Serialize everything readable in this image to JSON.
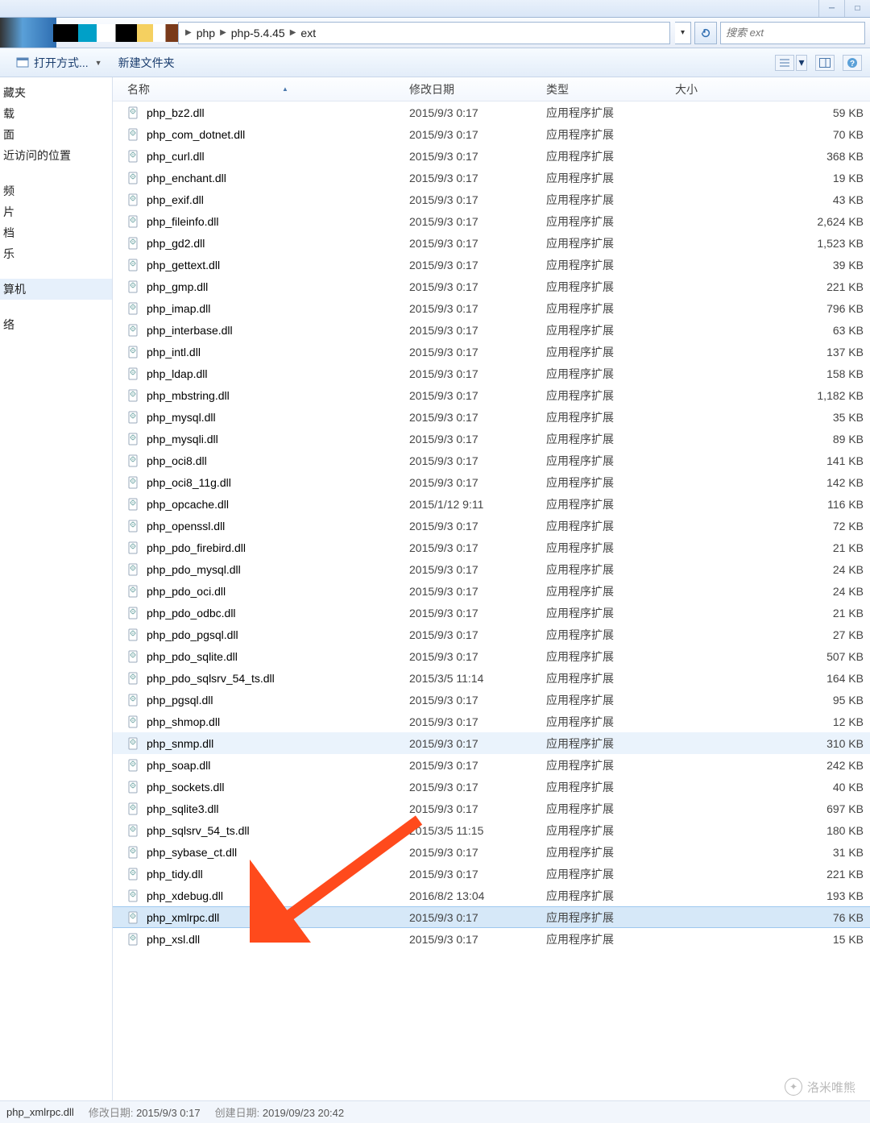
{
  "breadcrumb": {
    "seg1": "php",
    "seg2": "php-5.4.45",
    "seg3": "ext"
  },
  "search": {
    "placeholder": "搜索 ext"
  },
  "toolbar": {
    "open_with": "打开方式...",
    "new_folder": "新建文件夹"
  },
  "sidebar": {
    "items": [
      "藏夹",
      "载",
      "面",
      "近访问的位置",
      "",
      "频",
      "片",
      "档",
      "乐",
      "",
      "算机",
      "",
      "络"
    ],
    "selected_index": 10
  },
  "columns": {
    "name": "名称",
    "date": "修改日期",
    "type": "类型",
    "size": "大小"
  },
  "type_label": "应用程序扩展",
  "files": [
    {
      "n": "php_bz2.dll",
      "d": "2015/9/3 0:17",
      "s": "59 KB"
    },
    {
      "n": "php_com_dotnet.dll",
      "d": "2015/9/3 0:17",
      "s": "70 KB"
    },
    {
      "n": "php_curl.dll",
      "d": "2015/9/3 0:17",
      "s": "368 KB"
    },
    {
      "n": "php_enchant.dll",
      "d": "2015/9/3 0:17",
      "s": "19 KB"
    },
    {
      "n": "php_exif.dll",
      "d": "2015/9/3 0:17",
      "s": "43 KB"
    },
    {
      "n": "php_fileinfo.dll",
      "d": "2015/9/3 0:17",
      "s": "2,624 KB"
    },
    {
      "n": "php_gd2.dll",
      "d": "2015/9/3 0:17",
      "s": "1,523 KB"
    },
    {
      "n": "php_gettext.dll",
      "d": "2015/9/3 0:17",
      "s": "39 KB"
    },
    {
      "n": "php_gmp.dll",
      "d": "2015/9/3 0:17",
      "s": "221 KB"
    },
    {
      "n": "php_imap.dll",
      "d": "2015/9/3 0:17",
      "s": "796 KB"
    },
    {
      "n": "php_interbase.dll",
      "d": "2015/9/3 0:17",
      "s": "63 KB"
    },
    {
      "n": "php_intl.dll",
      "d": "2015/9/3 0:17",
      "s": "137 KB"
    },
    {
      "n": "php_ldap.dll",
      "d": "2015/9/3 0:17",
      "s": "158 KB"
    },
    {
      "n": "php_mbstring.dll",
      "d": "2015/9/3 0:17",
      "s": "1,182 KB"
    },
    {
      "n": "php_mysql.dll",
      "d": "2015/9/3 0:17",
      "s": "35 KB"
    },
    {
      "n": "php_mysqli.dll",
      "d": "2015/9/3 0:17",
      "s": "89 KB"
    },
    {
      "n": "php_oci8.dll",
      "d": "2015/9/3 0:17",
      "s": "141 KB"
    },
    {
      "n": "php_oci8_11g.dll",
      "d": "2015/9/3 0:17",
      "s": "142 KB"
    },
    {
      "n": "php_opcache.dll",
      "d": "2015/1/12 9:11",
      "s": "116 KB"
    },
    {
      "n": "php_openssl.dll",
      "d": "2015/9/3 0:17",
      "s": "72 KB"
    },
    {
      "n": "php_pdo_firebird.dll",
      "d": "2015/9/3 0:17",
      "s": "21 KB"
    },
    {
      "n": "php_pdo_mysql.dll",
      "d": "2015/9/3 0:17",
      "s": "24 KB"
    },
    {
      "n": "php_pdo_oci.dll",
      "d": "2015/9/3 0:17",
      "s": "24 KB"
    },
    {
      "n": "php_pdo_odbc.dll",
      "d": "2015/9/3 0:17",
      "s": "21 KB"
    },
    {
      "n": "php_pdo_pgsql.dll",
      "d": "2015/9/3 0:17",
      "s": "27 KB"
    },
    {
      "n": "php_pdo_sqlite.dll",
      "d": "2015/9/3 0:17",
      "s": "507 KB"
    },
    {
      "n": "php_pdo_sqlsrv_54_ts.dll",
      "d": "2015/3/5 11:14",
      "s": "164 KB"
    },
    {
      "n": "php_pgsql.dll",
      "d": "2015/9/3 0:17",
      "s": "95 KB"
    },
    {
      "n": "php_shmop.dll",
      "d": "2015/9/3 0:17",
      "s": "12 KB"
    },
    {
      "n": "php_snmp.dll",
      "d": "2015/9/3 0:17",
      "s": "310 KB"
    },
    {
      "n": "php_soap.dll",
      "d": "2015/9/3 0:17",
      "s": "242 KB"
    },
    {
      "n": "php_sockets.dll",
      "d": "2015/9/3 0:17",
      "s": "40 KB"
    },
    {
      "n": "php_sqlite3.dll",
      "d": "2015/9/3 0:17",
      "s": "697 KB"
    },
    {
      "n": "php_sqlsrv_54_ts.dll",
      "d": "2015/3/5 11:15",
      "s": "180 KB"
    },
    {
      "n": "php_sybase_ct.dll",
      "d": "2015/9/3 0:17",
      "s": "31 KB"
    },
    {
      "n": "php_tidy.dll",
      "d": "2015/9/3 0:17",
      "s": "221 KB"
    },
    {
      "n": "php_xdebug.dll",
      "d": "2016/8/2 13:04",
      "s": "193 KB"
    },
    {
      "n": "php_xmlrpc.dll",
      "d": "2015/9/3 0:17",
      "s": "76 KB"
    },
    {
      "n": "php_xsl.dll",
      "d": "2015/9/3 0:17",
      "s": "15 KB"
    }
  ],
  "hover_index": 29,
  "selected_index": 37,
  "status": {
    "filename": "php_xmlrpc.dll",
    "mod_label": "修改日期:",
    "mod_value": "2015/9/3 0:17",
    "create_label": "创建日期:",
    "create_value": "2019/09/23 20:42"
  },
  "watermark": "洛米唯熊"
}
